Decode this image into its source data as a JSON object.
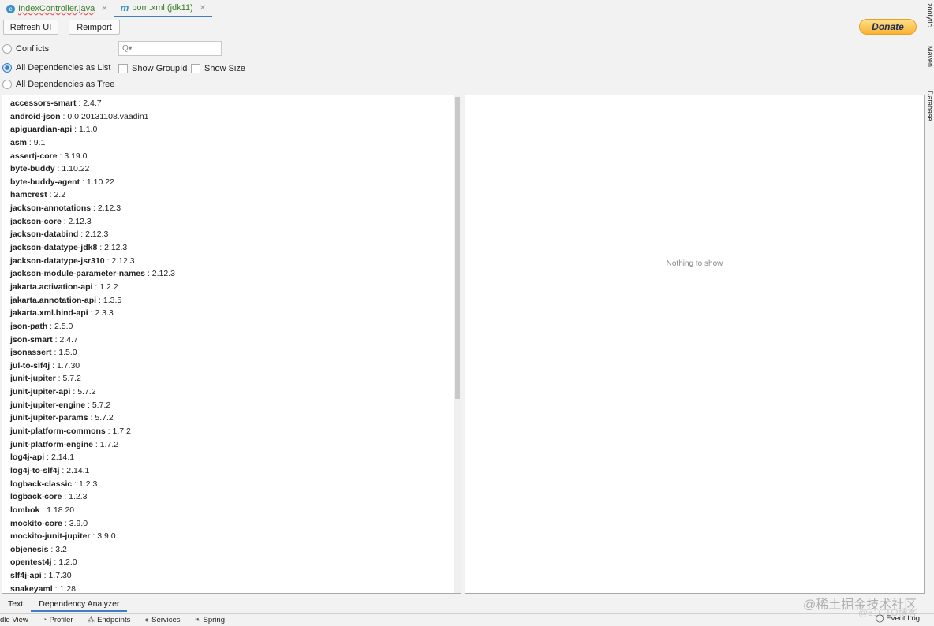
{
  "tabs": [
    {
      "label": "IndexController.java",
      "icon": "java-class-icon"
    },
    {
      "label": "pom.xml (jdk11)",
      "icon": "maven-icon"
    }
  ],
  "toolbar": {
    "refresh": "Refresh UI",
    "reimport": "Reimport",
    "donate": "Donate",
    "search_placeholder": "Q▾"
  },
  "options": {
    "conflicts": "Conflicts",
    "list": "All Dependencies as List",
    "tree": "All Dependencies as Tree",
    "show_groupid": "Show GroupId",
    "show_size": "Show Size",
    "selected": "All Dependencies as List"
  },
  "dependencies": [
    [
      "accessors-smart",
      "2.4.7"
    ],
    [
      "android-json",
      "0.0.20131108.vaadin1"
    ],
    [
      "apiguardian-api",
      "1.1.0"
    ],
    [
      "asm",
      "9.1"
    ],
    [
      "assertj-core",
      "3.19.0"
    ],
    [
      "byte-buddy",
      "1.10.22"
    ],
    [
      "byte-buddy-agent",
      "1.10.22"
    ],
    [
      "hamcrest",
      "2.2"
    ],
    [
      "jackson-annotations",
      "2.12.3"
    ],
    [
      "jackson-core",
      "2.12.3"
    ],
    [
      "jackson-databind",
      "2.12.3"
    ],
    [
      "jackson-datatype-jdk8",
      "2.12.3"
    ],
    [
      "jackson-datatype-jsr310",
      "2.12.3"
    ],
    [
      "jackson-module-parameter-names",
      "2.12.3"
    ],
    [
      "jakarta.activation-api",
      "1.2.2"
    ],
    [
      "jakarta.annotation-api",
      "1.3.5"
    ],
    [
      "jakarta.xml.bind-api",
      "2.3.3"
    ],
    [
      "json-path",
      "2.5.0"
    ],
    [
      "json-smart",
      "2.4.7"
    ],
    [
      "jsonassert",
      "1.5.0"
    ],
    [
      "jul-to-slf4j",
      "1.7.30"
    ],
    [
      "junit-jupiter",
      "5.7.2"
    ],
    [
      "junit-jupiter-api",
      "5.7.2"
    ],
    [
      "junit-jupiter-engine",
      "5.7.2"
    ],
    [
      "junit-jupiter-params",
      "5.7.2"
    ],
    [
      "junit-platform-commons",
      "1.7.2"
    ],
    [
      "junit-platform-engine",
      "1.7.2"
    ],
    [
      "log4j-api",
      "2.14.1"
    ],
    [
      "log4j-to-slf4j",
      "2.14.1"
    ],
    [
      "logback-classic",
      "1.2.3"
    ],
    [
      "logback-core",
      "1.2.3"
    ],
    [
      "lombok",
      "1.18.20"
    ],
    [
      "mockito-core",
      "3.9.0"
    ],
    [
      "mockito-junit-jupiter",
      "3.9.0"
    ],
    [
      "objenesis",
      "3.2"
    ],
    [
      "opentest4j",
      "1.2.0"
    ],
    [
      "slf4j-api",
      "1.7.30"
    ],
    [
      "snakeyaml",
      "1.28"
    ]
  ],
  "detail": {
    "empty": "Nothing to show"
  },
  "right_sidebar": [
    "zoolytic",
    "Maven",
    "Database"
  ],
  "bottom_tabs": [
    "Text",
    "Dependency Analyzer"
  ],
  "status": [
    "dle View",
    "Profiler",
    "Endpoints",
    "Services",
    "Spring"
  ],
  "event_log": "Event Log",
  "watermark": [
    "@稀土掘金技术社区",
    "@51CTO博客"
  ]
}
